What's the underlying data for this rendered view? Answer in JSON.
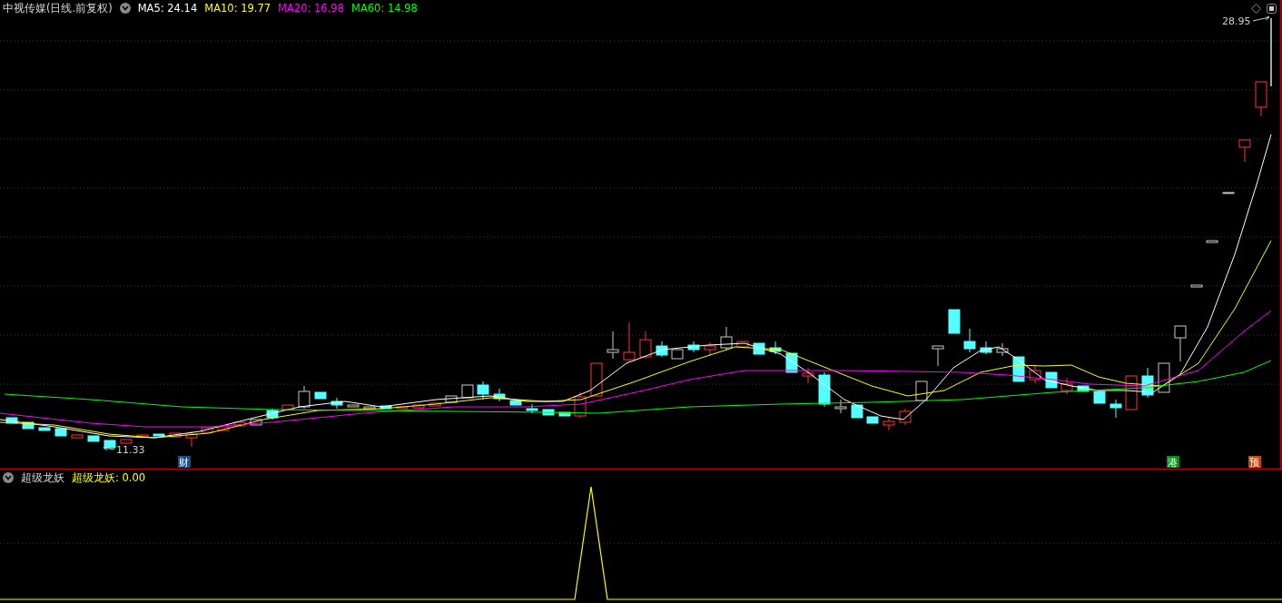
{
  "chart_header": {
    "title": "中视传媒(日线.前复权)",
    "moving_averages": [
      {
        "label": "MA5: 24.14",
        "color": "#ffffff"
      },
      {
        "label": "MA10: 19.77",
        "color": "#ffff00"
      },
      {
        "label": "MA20: 16.98",
        "color": "#ff00ff"
      },
      {
        "label": "MA60: 14.98",
        "color": "#00ff00"
      }
    ]
  },
  "price_labels": {
    "high": "28.95",
    "low": "11.33"
  },
  "event_markers": [
    {
      "text": "财",
      "color": "#1e4f82"
    },
    {
      "text": "港",
      "color": "#0a8a1a"
    },
    {
      "text": "预",
      "color": "#c8460a"
    }
  ],
  "indicator_panel": {
    "name": "超级龙妖",
    "series_label": "超级龙妖: 0.00",
    "color": "#ffff00"
  }
}
